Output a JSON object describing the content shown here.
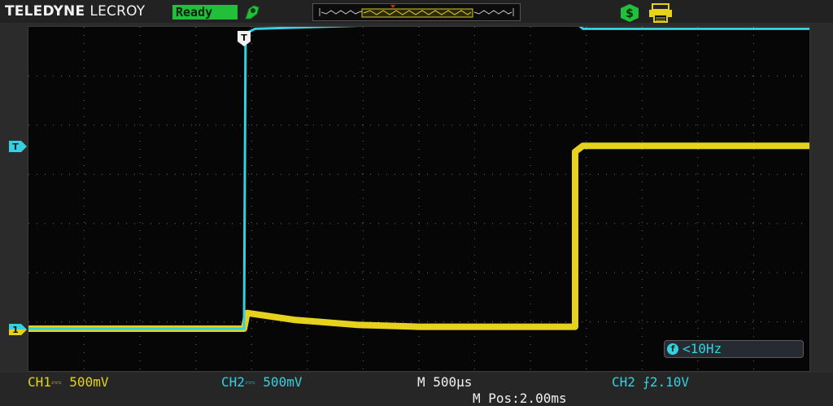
{
  "header": {
    "brand_part1": "TELEDYNE",
    "brand_part2": "LECROY",
    "status": "Ready",
    "icons": [
      "ready-hand-icon",
      "settings-dollar-icon",
      "printer-icon"
    ]
  },
  "colors": {
    "ch1": "#e6d21c",
    "ch2": "#35d1e0",
    "status": "#22c03a",
    "background": "#060606"
  },
  "markers": {
    "trigger_top": "T",
    "trigger_level": "T",
    "ground": "1"
  },
  "freq_counter": {
    "icon": "f",
    "value": "<10Hz"
  },
  "footer": {
    "ch1_scale": "CH1⎓ 500mV",
    "ch2_scale": "CH2⎓ 500mV",
    "timebase": "M 500μs",
    "trigger": "CH2 ⨍2.10V",
    "position": "M Pos:2.00ms"
  },
  "chart_data": {
    "type": "line",
    "x_unit": "ms",
    "xlim": [
      -0.5,
      4.5
    ],
    "grid": true,
    "series": [
      {
        "name": "CH1",
        "x": [
          -0.5,
          0.88,
          0.9,
          1.2,
          1.6,
          2.0,
          2.5,
          3.0,
          3.0,
          3.05,
          4.5
        ],
        "y": [
          0.0,
          0.0,
          0.16,
          0.09,
          0.04,
          0.02,
          0.02,
          0.02,
          1.8,
          1.86,
          1.86
        ]
      },
      {
        "name": "CH2",
        "x": [
          -0.5,
          0.88,
          0.89,
          0.95,
          2.0,
          3.0,
          3.05,
          4.5
        ],
        "y": [
          0.0,
          0.0,
          3.0,
          3.05,
          3.1,
          3.12,
          3.05,
          3.05
        ]
      }
    ]
  }
}
